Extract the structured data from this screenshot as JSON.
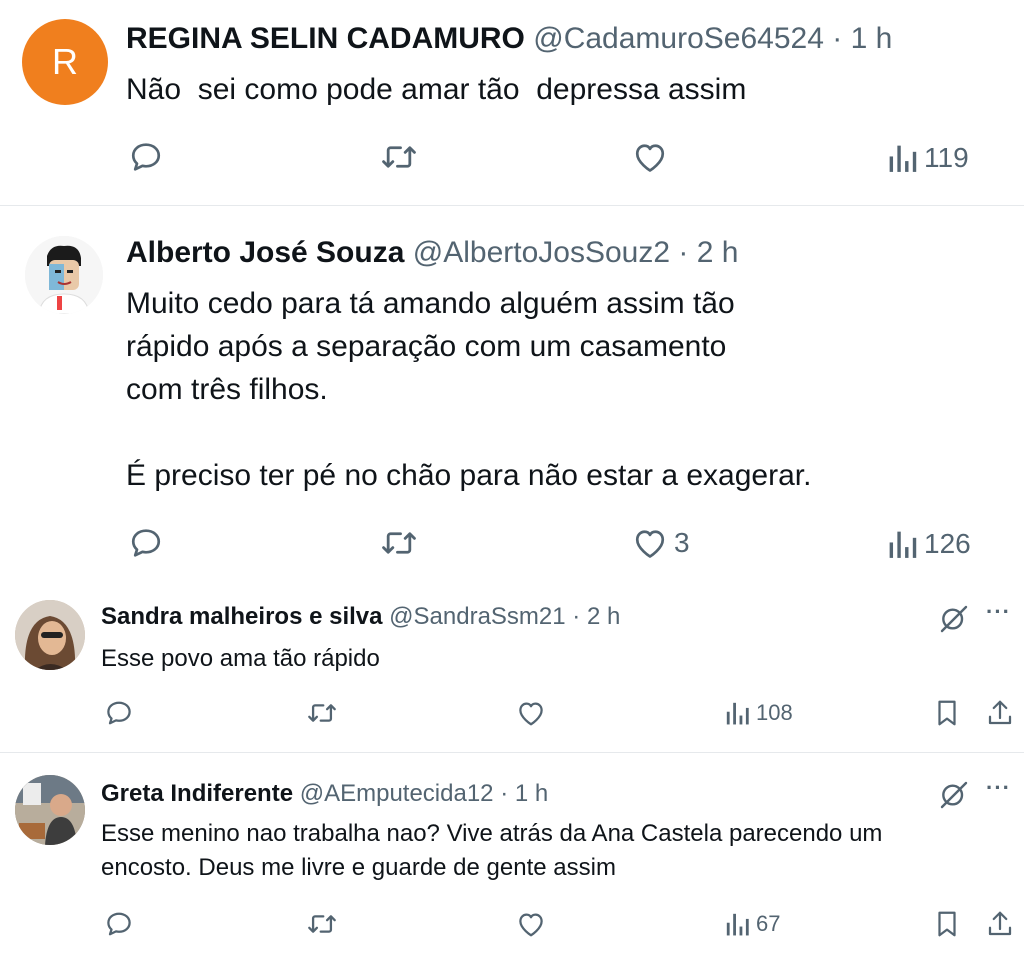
{
  "colors": {
    "text": "#0f1419",
    "muted": "#536471",
    "avatar_bg": "#f07f1e",
    "divider": "#e6e9ec"
  },
  "tweets": [
    {
      "avatar_letter": "R",
      "name": "REGINA SELIN CADAMURO",
      "handle": "@CadamuroSe64524",
      "sep": "·",
      "time": "1 h",
      "text": [
        "Não  sei como pode amar tão  depressa assim"
      ],
      "likes": "",
      "views": "119"
    },
    {
      "avatar_icon": "cartoon-avatar-icon",
      "name": "Alberto José Souza",
      "handle": "@AlbertoJosSouz2",
      "sep": "·",
      "time": "2 h",
      "text": [
        "Muito cedo para tá amando alguém assim tão",
        "rápido após a separação com um casamento",
        "com três filhos.",
        "",
        "É preciso ter pé no chão para não estar a exagerar."
      ],
      "likes": "3",
      "views": "126"
    },
    {
      "avatar_icon": "photo-avatar-icon",
      "name": "Sandra malheiros e silva",
      "handle": "@SandraSsm21",
      "sep": "·",
      "time": "2 h",
      "text": [
        "Esse povo ama tão rápido"
      ],
      "likes": "",
      "views": "108"
    },
    {
      "avatar_icon": "photo-avatar-icon",
      "name": "Greta Indiferente",
      "handle": "@AEmputecida12",
      "sep": "·",
      "time": "1 h",
      "text": [
        "Esse menino nao trabalha nao? Vive atrás da Ana Castela parecendo um",
        "encosto. Deus me livre e guarde de gente assim"
      ],
      "likes": "",
      "views": "67"
    }
  ],
  "more_label": "···"
}
